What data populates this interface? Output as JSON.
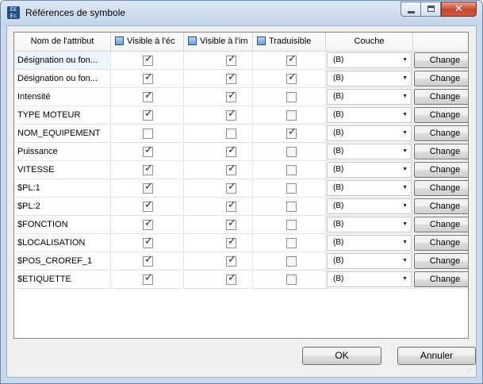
{
  "window": {
    "title": "Références de symbole",
    "icon": "app-icon",
    "controls": [
      "minimize-icon",
      "maximize-icon",
      "close-icon"
    ]
  },
  "table": {
    "headers": {
      "attribute": "Nom de l'attribut",
      "visible_screen": "Visible à l'éc",
      "visible_print": "Visible à l'im",
      "translatable": "Traduisible",
      "layer": "Couche",
      "action": ""
    },
    "rows": [
      {
        "name": "Désignation ou fon...",
        "visible_screen": true,
        "visible_print": true,
        "translatable": true,
        "layer": "(B)",
        "action": "Change"
      },
      {
        "name": "Désignation ou fon...",
        "visible_screen": true,
        "visible_print": true,
        "translatable": true,
        "layer": "(B)",
        "action": "Change"
      },
      {
        "name": "Intensité",
        "visible_screen": true,
        "visible_print": true,
        "translatable": false,
        "layer": "(B)",
        "action": "Change"
      },
      {
        "name": "TYPE MOTEUR",
        "visible_screen": true,
        "visible_print": true,
        "translatable": false,
        "layer": "(B)",
        "action": "Change"
      },
      {
        "name": "NOM_EQUIPEMENT",
        "visible_screen": false,
        "visible_print": false,
        "translatable": true,
        "layer": "(B)",
        "action": "Change"
      },
      {
        "name": "Puissance",
        "visible_screen": true,
        "visible_print": true,
        "translatable": false,
        "layer": "(B)",
        "action": "Change"
      },
      {
        "name": "VITESSE",
        "visible_screen": true,
        "visible_print": true,
        "translatable": false,
        "layer": "(B)",
        "action": "Change"
      },
      {
        "name": "$PL:1",
        "visible_screen": true,
        "visible_print": true,
        "translatable": false,
        "layer": "(B)",
        "action": "Change"
      },
      {
        "name": "$PL:2",
        "visible_screen": true,
        "visible_print": true,
        "translatable": false,
        "layer": "(B)",
        "action": "Change"
      },
      {
        "name": "$FONCTION",
        "visible_screen": true,
        "visible_print": true,
        "translatable": false,
        "layer": "(B)",
        "action": "Change"
      },
      {
        "name": "$LOCALISATION",
        "visible_screen": true,
        "visible_print": true,
        "translatable": false,
        "layer": "(B)",
        "action": "Change"
      },
      {
        "name": "$POS_CROREF_1",
        "visible_screen": true,
        "visible_print": true,
        "translatable": false,
        "layer": "(B)",
        "action": "Change"
      },
      {
        "name": "$ETIQUETTE",
        "visible_screen": true,
        "visible_print": true,
        "translatable": false,
        "layer": "(B)",
        "action": "Change"
      }
    ]
  },
  "buttons": {
    "ok": "OK",
    "cancel": "Annuler"
  },
  "colors": {
    "title_bar": "#c4d5ea",
    "close_button": "#c7462f",
    "selected_row": "#eef4fb"
  }
}
